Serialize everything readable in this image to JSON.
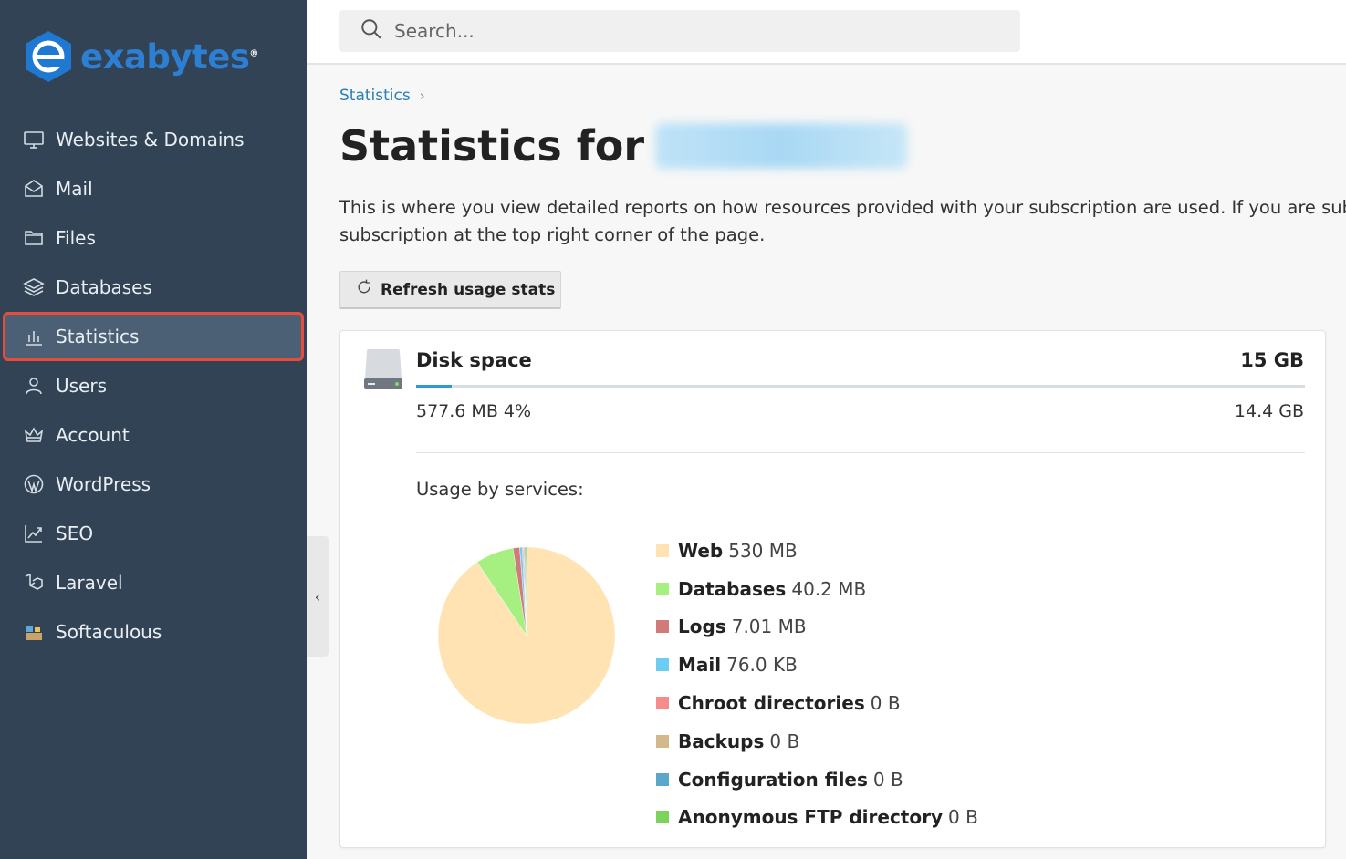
{
  "brand": {
    "name": "exabytes",
    "registered": "®"
  },
  "search": {
    "placeholder": "Search..."
  },
  "sidebar": {
    "items": [
      {
        "label": "Websites & Domains",
        "icon": "monitor-icon"
      },
      {
        "label": "Mail",
        "icon": "envelope-icon"
      },
      {
        "label": "Files",
        "icon": "folder-icon"
      },
      {
        "label": "Databases",
        "icon": "database-layers-icon"
      },
      {
        "label": "Statistics",
        "icon": "bar-chart-icon",
        "active": true
      },
      {
        "label": "Users",
        "icon": "user-icon"
      },
      {
        "label": "Account",
        "icon": "crown-icon"
      },
      {
        "label": "WordPress",
        "icon": "wordpress-icon"
      },
      {
        "label": "SEO",
        "icon": "trend-chart-icon"
      },
      {
        "label": "Laravel",
        "icon": "laravel-icon"
      },
      {
        "label": "Softaculous",
        "icon": "softaculous-icon"
      }
    ],
    "collapse_glyph": "‹"
  },
  "breadcrumb": {
    "item": "Statistics",
    "separator": "›"
  },
  "page": {
    "title_prefix": "Statistics for",
    "description_line1": "This is where you view detailed reports on how resources provided with your subscription are used. If you are sub",
    "description_line2": "subscription at the top right corner of the page.",
    "refresh_label": "Refresh usage stats"
  },
  "disk": {
    "title": "Disk space",
    "total": "15 GB",
    "used": "577.6 MB 4%",
    "free": "14.4 GB",
    "used_fraction": 0.04,
    "usage_label": "Usage by services:"
  },
  "chart_data": {
    "type": "pie",
    "series": [
      {
        "name": "Web",
        "value_label": "530 MB",
        "value_mb": 530,
        "color": "#ffe3b3"
      },
      {
        "name": "Databases",
        "value_label": "40.2 MB",
        "value_mb": 40.2,
        "color": "#a6ef81"
      },
      {
        "name": "Logs",
        "value_label": "7.01 MB",
        "value_mb": 7.01,
        "color": "#d07a7a"
      },
      {
        "name": "Mail",
        "value_label": "76.0 KB",
        "value_mb": 0.076,
        "color": "#6ccdf2"
      },
      {
        "name": "Chroot directories",
        "value_label": "0 B",
        "value_mb": 0,
        "color": "#f58b8b"
      },
      {
        "name": "Backups",
        "value_label": "0 B",
        "value_mb": 0,
        "color": "#d3b88c"
      },
      {
        "name": "Configuration files",
        "value_label": "0 B",
        "value_mb": 0,
        "color": "#5aa7cc"
      },
      {
        "name": "Anonymous FTP directory",
        "value_label": "0 B",
        "value_mb": 0,
        "color": "#7bd35a"
      }
    ]
  }
}
